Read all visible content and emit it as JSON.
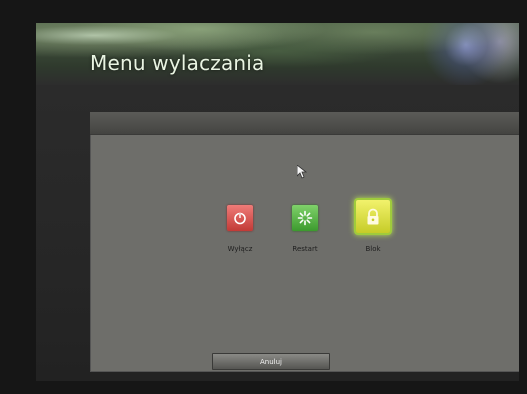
{
  "window": {
    "title": "Menu wylaczania"
  },
  "options": [
    {
      "label": "Wyłącz",
      "icon": "power-icon",
      "color": "#d9514d"
    },
    {
      "label": "Restart",
      "icon": "restart-icon",
      "color": "#55b544"
    },
    {
      "label": "Blok",
      "icon": "lock-icon",
      "color": "#dce044"
    }
  ],
  "footer": {
    "cancel_label": "Anuluj"
  },
  "colors": {
    "panel": "#6e6e6a",
    "title": "#e9f4e2",
    "selected_glow": "#b9e254"
  }
}
